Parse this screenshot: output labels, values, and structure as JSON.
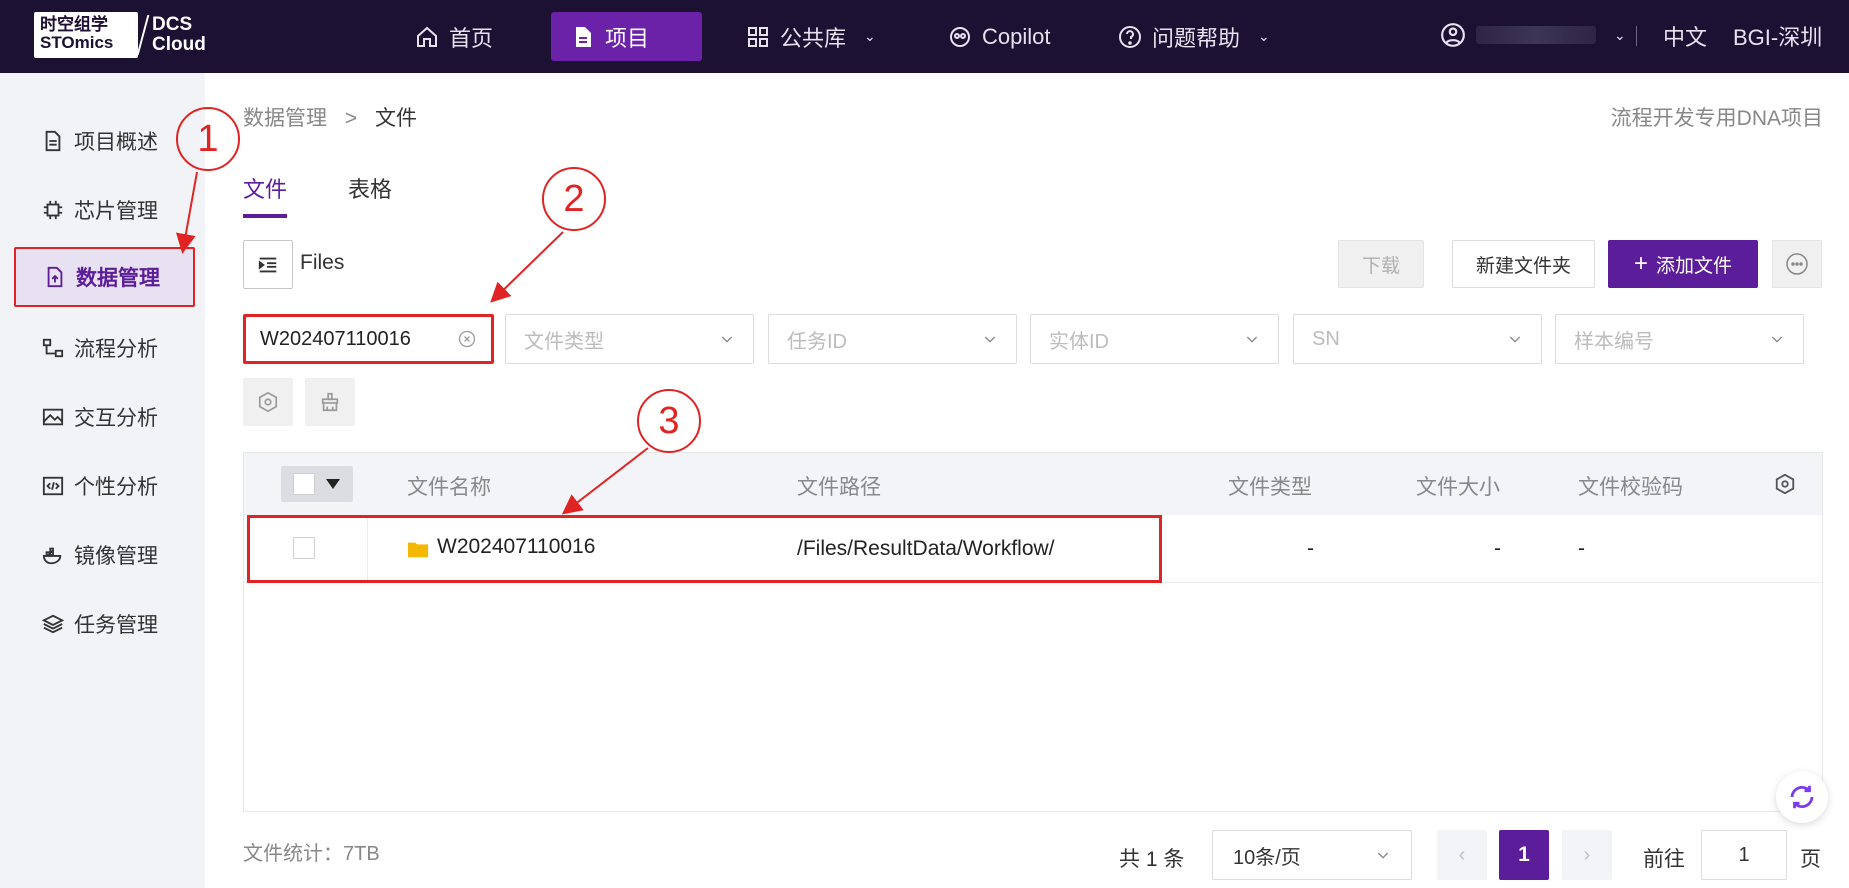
{
  "topbar": {
    "logo_top": "时空组学",
    "logo_bottom": "STOmics",
    "logo_dcs": "DCS",
    "logo_cloud": "Cloud",
    "nav": [
      {
        "label": "首页",
        "icon": "home-icon"
      },
      {
        "label": "项目",
        "icon": "file-icon"
      },
      {
        "label": "公共库",
        "icon": "grid-icon"
      },
      {
        "label": "Copilot",
        "icon": "copilot-icon"
      },
      {
        "label": "问题帮助",
        "icon": "help-icon"
      }
    ],
    "language": "中文",
    "region": "BGI-深圳"
  },
  "sidebar": {
    "items": [
      {
        "label": "项目概述",
        "icon": "document-icon"
      },
      {
        "label": "芯片管理",
        "icon": "chip-icon"
      },
      {
        "label": "数据管理",
        "icon": "file-upload-icon"
      },
      {
        "label": "流程分析",
        "icon": "flow-icon"
      },
      {
        "label": "交互分析",
        "icon": "image-icon"
      },
      {
        "label": "个性分析",
        "icon": "code-icon"
      },
      {
        "label": "镜像管理",
        "icon": "docker-icon"
      },
      {
        "label": "任务管理",
        "icon": "layers-icon"
      }
    ]
  },
  "main": {
    "breadcrumb": {
      "parent": "数据管理",
      "sep": ">",
      "current": "文件"
    },
    "project_name": "流程开发专用DNA项目",
    "tabs": [
      "文件",
      "表格"
    ],
    "files_label": "Files",
    "buttons": {
      "download": "下载",
      "new_folder": "新建文件夹",
      "add_file": "添加文件",
      "add_plus": "+"
    },
    "filters": {
      "search_value": "W202407110016",
      "file_type": "文件类型",
      "task_id": "任务ID",
      "entity_id": "实体ID",
      "sn": "SN",
      "sample_no": "样本编号"
    },
    "table": {
      "columns": [
        "文件名称",
        "文件路径",
        "文件类型",
        "文件大小",
        "文件校验码"
      ],
      "rows": [
        {
          "name": "W202407110016",
          "path": "/Files/ResultData/Workflow/",
          "type": "-",
          "size": "-",
          "checksum": "-"
        }
      ]
    },
    "stats": "文件统计：7TB",
    "pagination": {
      "total": "共 1 条",
      "page_size": "10条/页",
      "current": "1",
      "goto_label": "前往",
      "goto_value": "1",
      "goto_unit": "页"
    }
  },
  "annotations": [
    "1",
    "2",
    "3"
  ],
  "colors": {
    "accent": "#5b1d99",
    "topbar": "#1c1033",
    "annotation": "#e02424"
  }
}
